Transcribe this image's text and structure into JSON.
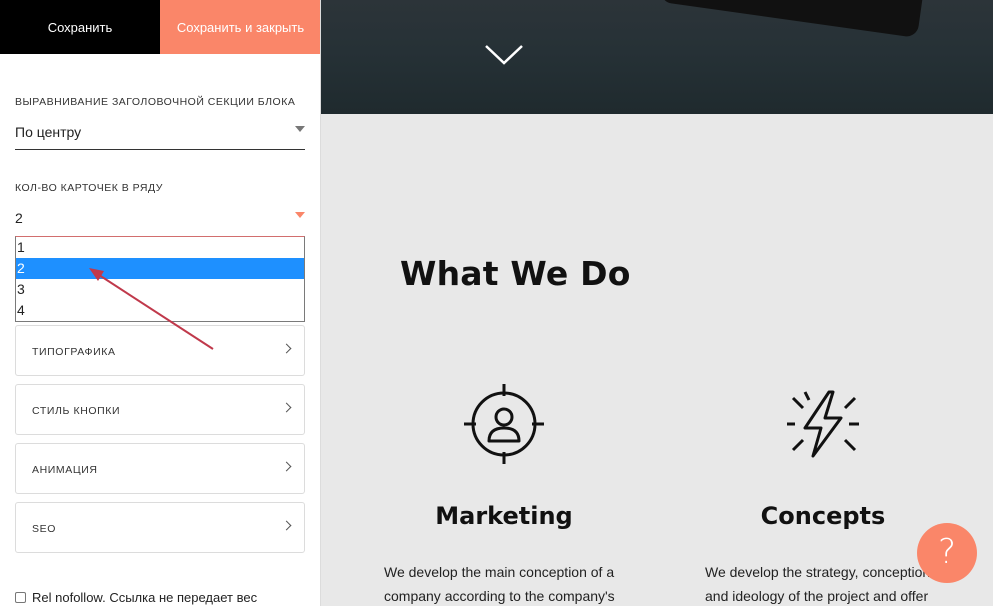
{
  "toolbar": {
    "save_label": "Сохранить",
    "save_close_label": "Сохранить и закрыть"
  },
  "settings": {
    "header_alignment": {
      "label": "Выравнивание заголовочной секции блока",
      "value": "По центру"
    },
    "cards_per_row": {
      "label": "Кол-во карточек в ряду",
      "value": "2",
      "options": [
        "1",
        "2",
        "3",
        "4"
      ],
      "selected_index": 1
    },
    "sections": [
      {
        "label": "Типографика"
      },
      {
        "label": "Стиль кнопки"
      },
      {
        "label": "Анимация"
      },
      {
        "label": "SEO"
      }
    ],
    "rel_nofollow": {
      "label": "Rel nofollow. Ссылка не передает вес",
      "checked": false
    }
  },
  "preview": {
    "heading": "What We Do",
    "cards": [
      {
        "icon": "target-user-icon",
        "title": "Marketing",
        "text_lines": [
          "We develop the main conception of a",
          "company according to the company's"
        ]
      },
      {
        "icon": "lightning-icon",
        "title": "Concepts",
        "text_lines": [
          "We develop the strategy, conception",
          "and ideology of the project and offer"
        ]
      }
    ]
  },
  "help_button": {
    "icon": "question-icon",
    "glyph": "?"
  },
  "colors": {
    "accent": "#fa8669",
    "selected_option": "#1e90ff",
    "annotation_arrow": "#c0394b"
  }
}
